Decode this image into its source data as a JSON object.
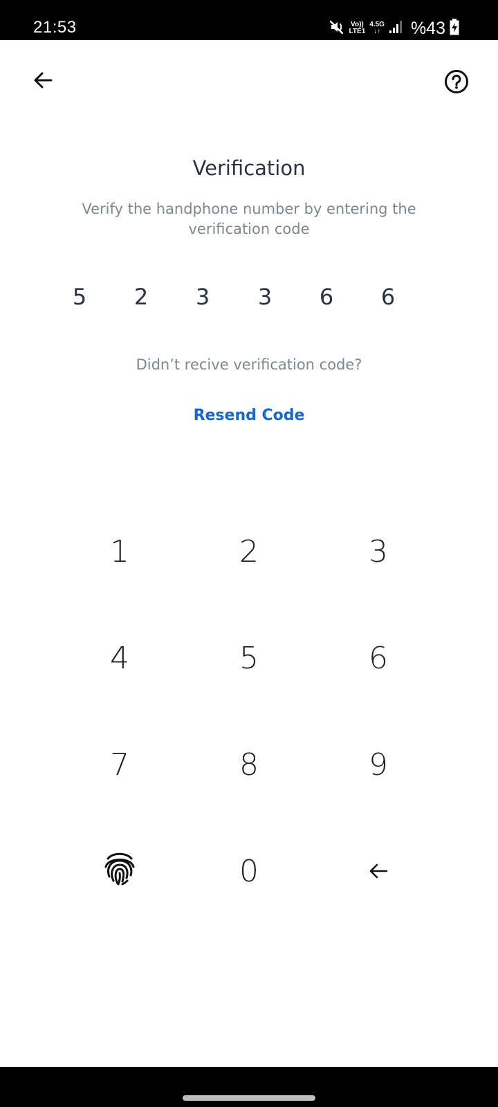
{
  "status_bar": {
    "time": "21:53",
    "network_top": "Vo))",
    "network_bottom": "LTE1",
    "network_gen": "4.5G",
    "battery": "%43"
  },
  "header": {
    "back_icon": "arrow-left-icon",
    "help_icon": "question-circle-icon"
  },
  "page": {
    "title": "Verification",
    "subtitle": "Verify the handphone number by entering the verification code",
    "code_digits": [
      "5",
      "2",
      "3",
      "3",
      "6",
      "6"
    ],
    "didnt_receive": "Didn’t recive verification code?",
    "resend_label": "Resend Code"
  },
  "keypad": {
    "keys": [
      "1",
      "2",
      "3",
      "4",
      "5",
      "6",
      "7",
      "8",
      "9",
      "0"
    ],
    "fingerprint_icon": "fingerprint-icon",
    "backspace_icon": "backspace-arrow-icon"
  },
  "colors": {
    "accent": "#1567d4",
    "title_text": "#2a3342",
    "muted_text": "#7b8794"
  }
}
